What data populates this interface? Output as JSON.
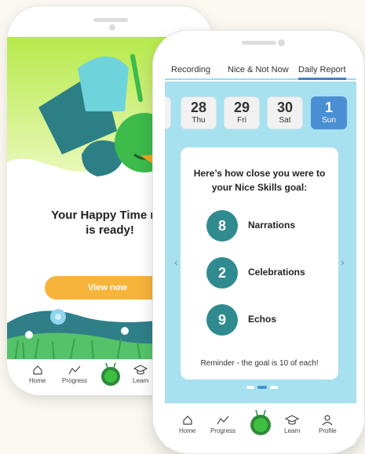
{
  "back_phone": {
    "title_line1": "Your Happy Time rep",
    "title_line2": "is ready!",
    "cta": "View now",
    "tabs": [
      "Home",
      "Progress",
      "",
      "Learn"
    ]
  },
  "front_phone": {
    "tabs": [
      "Recording",
      "Nice & Not Now",
      "Daily Report"
    ],
    "active_tab": "Daily Report",
    "days": [
      {
        "num": "28",
        "wday": "Thu"
      },
      {
        "num": "29",
        "wday": "Fri"
      },
      {
        "num": "30",
        "wday": "Sat"
      },
      {
        "num": "1",
        "wday": "Sun"
      }
    ],
    "card": {
      "heading_line1": "Here’s how close you were to",
      "heading_line2": "your Nice Skills goal:",
      "skills": [
        {
          "count": "8",
          "label": "Narrations"
        },
        {
          "count": "2",
          "label": "Celebrations"
        },
        {
          "count": "9",
          "label": "Echos"
        }
      ],
      "reminder": "Reminder - the goal is 10 of each!"
    },
    "arrows": {
      "left": "‹",
      "right": "›"
    },
    "bottom_tabs": [
      "Home",
      "Progress",
      "",
      "Learn",
      "Profile"
    ]
  },
  "colors": {
    "accent_blue": "#4a8fd4",
    "teal": "#2f8b8f",
    "screen_bg": "#a7e1ef",
    "cta_orange": "#f6b43b",
    "bug_green": "#3fbf3f"
  },
  "icons": [
    "home-icon",
    "progress-icon",
    "bug-logo-icon",
    "learn-icon",
    "profile-icon"
  ]
}
